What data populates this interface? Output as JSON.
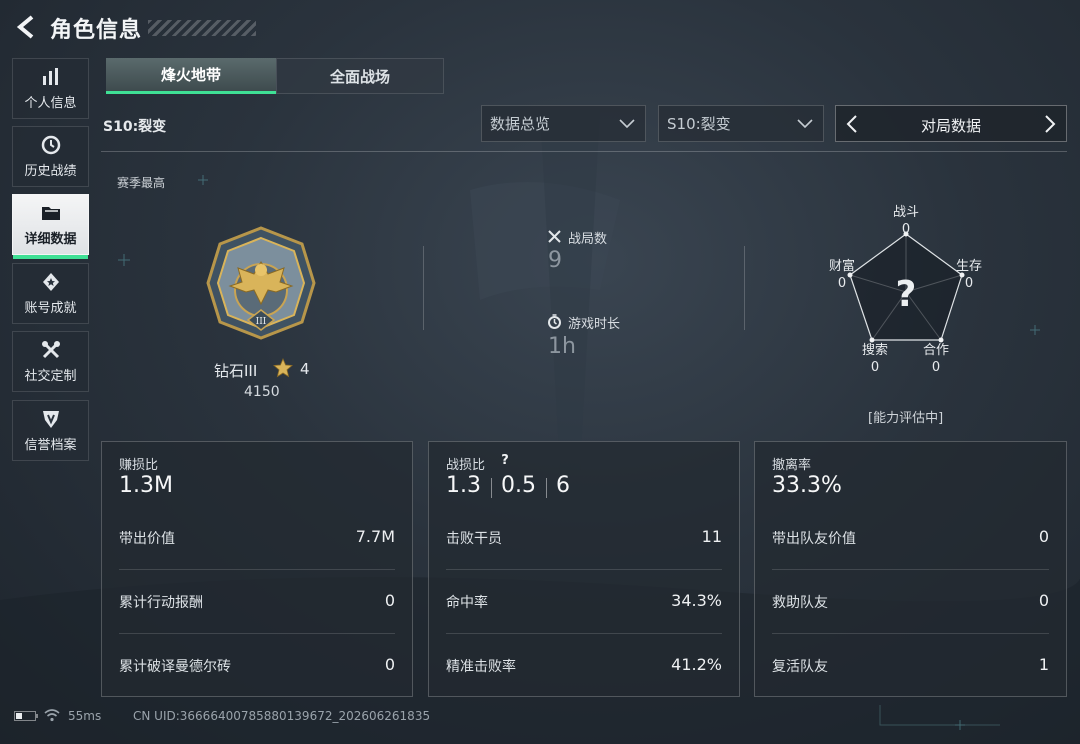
{
  "header": {
    "title": "角色信息"
  },
  "sidebar": {
    "items": [
      {
        "label": "个人信息",
        "icon": "bar-chart-icon",
        "active": false
      },
      {
        "label": "历史战绩",
        "icon": "clock-icon",
        "active": false
      },
      {
        "label": "详细数据",
        "icon": "folder-icon",
        "active": true
      },
      {
        "label": "账号成就",
        "icon": "medal-icon",
        "active": false
      },
      {
        "label": "社交定制",
        "icon": "tools-icon",
        "active": false
      },
      {
        "label": "信誉档案",
        "icon": "shield-icon",
        "active": false
      }
    ]
  },
  "mode_tabs": [
    {
      "label": "烽火地带",
      "active": true
    },
    {
      "label": "全面战场",
      "active": false
    }
  ],
  "filters": {
    "season_label": "S10:裂变",
    "data_dropdown": "数据总览",
    "season_dropdown": "S10:裂变",
    "match_selector": "对局数据"
  },
  "season_best": {
    "title": "赛季最高",
    "rank_name": "钻石III",
    "rank_stars": "4",
    "rank_points": "4150"
  },
  "match_stats": {
    "matches_label": "战局数",
    "matches_value": "9",
    "playtime_label": "游戏时长",
    "playtime_value": "1h"
  },
  "ability": {
    "combat_label": "战斗",
    "combat_value": "0",
    "survival_label": "生存",
    "survival_value": "0",
    "teamwork_label": "合作",
    "teamwork_value": "0",
    "search_label": "搜索",
    "search_value": "0",
    "wealth_label": "财富",
    "wealth_value": "0",
    "status": "[能力评估中]"
  },
  "panels": {
    "profit": {
      "title": "赚损比",
      "value": "1.3M",
      "rows": [
        {
          "label": "带出价值",
          "value": "7.7M"
        },
        {
          "label": "累计行动报酬",
          "value": "0"
        },
        {
          "label": "累计破译曼德尔砖",
          "value": "0"
        }
      ]
    },
    "kd": {
      "title": "战损比",
      "help_symbol": "?",
      "values": [
        "1.3",
        "0.5",
        "6"
      ],
      "rows": [
        {
          "label": "击败干员",
          "value": "11"
        },
        {
          "label": "命中率",
          "value": "34.3%"
        },
        {
          "label": "精准击败率",
          "value": "41.2%"
        }
      ]
    },
    "extract": {
      "title": "撤离率",
      "value": "33.3%",
      "rows": [
        {
          "label": "带出队友价值",
          "value": "0"
        },
        {
          "label": "救助队友",
          "value": "0"
        },
        {
          "label": "复活队友",
          "value": "1"
        }
      ]
    }
  },
  "footer": {
    "ping": "55ms",
    "uid": "CN UID:3666640078588013967​2_202606261835"
  },
  "colors": {
    "accent": "#3fe095",
    "gold": "#d9b45a"
  }
}
